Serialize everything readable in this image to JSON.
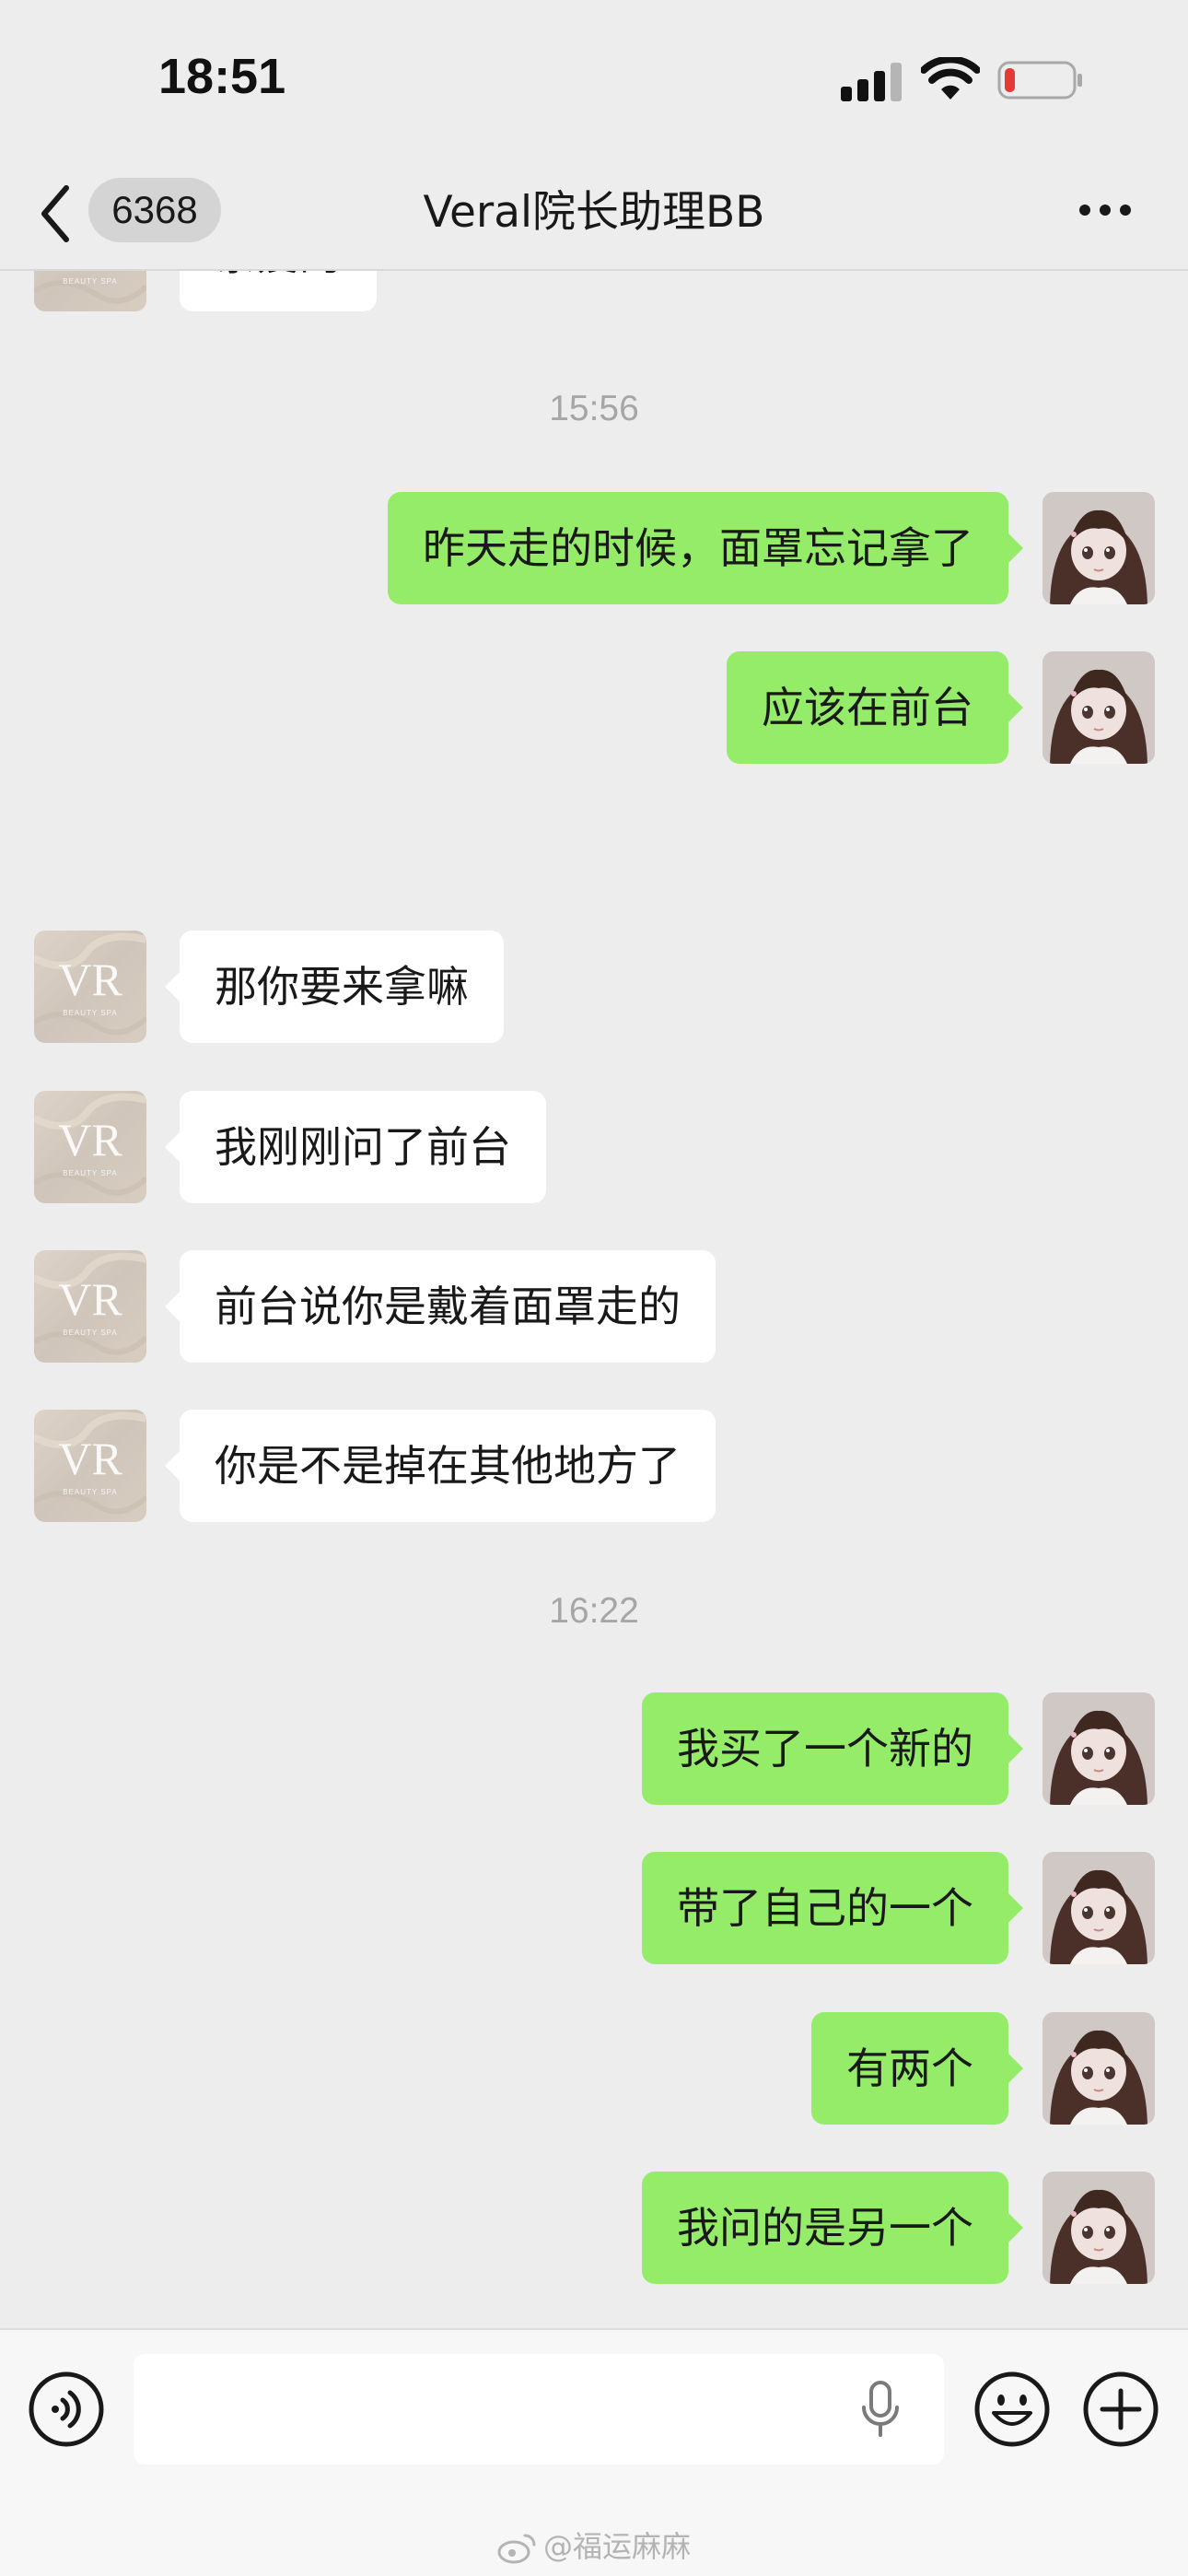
{
  "status_bar": {
    "time": "18:51",
    "battery_color": "#e53935"
  },
  "header": {
    "back_icon": "chevron-left-icon",
    "unread_count": "6368",
    "title": "Veral院长助理BB",
    "more_icon": "ellipsis-icon"
  },
  "messages": [
    {
      "type": "in",
      "text": "亲爱的"
    },
    {
      "type": "time",
      "text": "15:56"
    },
    {
      "type": "out",
      "text": "昨天走的时候，面罩忘记拿了"
    },
    {
      "type": "out",
      "text": "应该在前台"
    },
    {
      "type": "in",
      "text": "那你要来拿嘛"
    },
    {
      "type": "in",
      "text": "我刚刚问了前台"
    },
    {
      "type": "in",
      "text": "前台说你是戴着面罩走的"
    },
    {
      "type": "in",
      "text": "你是不是掉在其他地方了"
    },
    {
      "type": "time",
      "text": "16:22"
    },
    {
      "type": "out",
      "text": "我买了一个新的"
    },
    {
      "type": "out",
      "text": "带了自己的一个"
    },
    {
      "type": "out",
      "text": "有两个"
    },
    {
      "type": "out",
      "text": "我问的是另一个"
    }
  ],
  "contact_avatar": {
    "monogram": "VR",
    "brand_text": "BEAUTY SPA"
  },
  "input_bar": {
    "voice_icon": "voice-wave-icon",
    "input_value": "",
    "mic_icon": "microphone-icon",
    "emoji_icon": "smiley-icon",
    "plus_icon": "plus-circle-icon"
  },
  "watermark": "@福运麻麻",
  "colors": {
    "background": "#ededed",
    "outgoing_bubble": "#95ec69",
    "incoming_bubble": "#ffffff",
    "timestamp": "#a6a6a6"
  }
}
